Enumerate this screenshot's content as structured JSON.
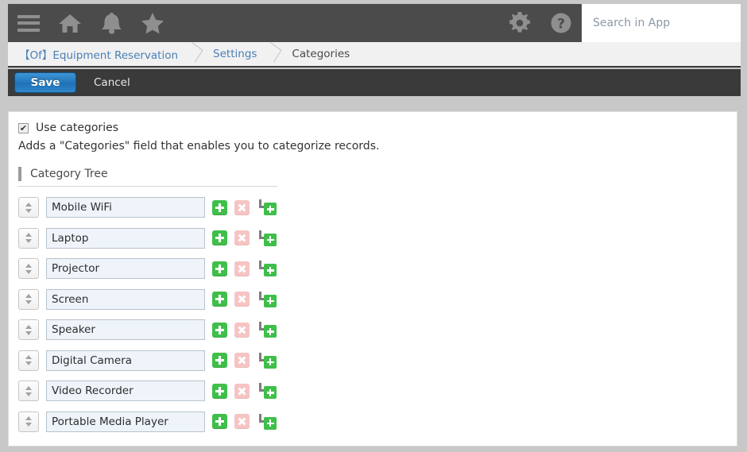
{
  "header": {
    "icons": [
      {
        "name": "hamburger-menu-icon",
        "label": "Menu"
      },
      {
        "name": "home-icon",
        "label": "Home"
      },
      {
        "name": "bell-icon",
        "label": "Notifications"
      },
      {
        "name": "star-icon",
        "label": "Favorites"
      },
      {
        "name": "gear-icon",
        "label": "Settings"
      },
      {
        "name": "help-icon",
        "label": "Help"
      }
    ],
    "search": {
      "placeholder": "Search in App",
      "value": ""
    },
    "bar_color": "#4b4b4b"
  },
  "breadcrumb": {
    "items": [
      {
        "label": "【Of】Equipment Reservation",
        "current": false
      },
      {
        "label": "Settings",
        "current": false
      },
      {
        "label": "Categories",
        "current": true
      }
    ],
    "link_color": "#4a7fb5",
    "current_color": "#4a4a4a"
  },
  "toolbar": {
    "save_label": "Save",
    "cancel_label": "Cancel",
    "save_color": "#2277bd",
    "bar_color": "#3a3a3a"
  },
  "main": {
    "use_categories": {
      "label": "Use categories",
      "checked": true,
      "checkmark": "✔"
    },
    "help_text": "Adds a \"Categories\" field that enables you to categorize records.",
    "tree": {
      "title": "Category Tree",
      "rows": [
        {
          "value": "Mobile WiFi"
        },
        {
          "value": "Laptop"
        },
        {
          "value": "Projector"
        },
        {
          "value": "Screen"
        },
        {
          "value": "Speaker"
        },
        {
          "value": "Digital Camera"
        },
        {
          "value": "Video Recorder"
        },
        {
          "value": "Portable Media Player"
        }
      ],
      "row_actions": {
        "add_label": "Add category",
        "delete_label": "Delete category",
        "add_child_label": "Add sub-category"
      },
      "add_color": "#3fbf4a",
      "delete_color": "#f6c4c4"
    }
  }
}
